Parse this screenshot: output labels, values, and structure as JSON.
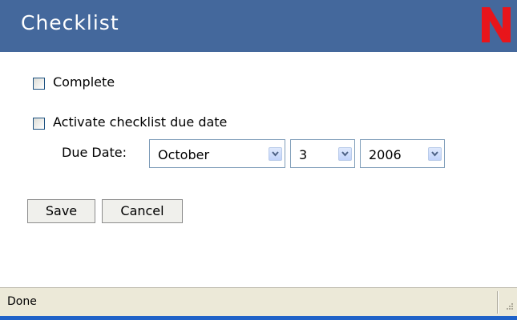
{
  "window": {
    "title": "Checklist"
  },
  "form": {
    "complete_label": "Complete",
    "activate_label": "Activate checklist due date",
    "due_date_label": "Due Date:",
    "month": "October",
    "day": "3",
    "year": "2006"
  },
  "buttons": {
    "save": "Save",
    "cancel": "Cancel"
  },
  "status": {
    "text": "Done"
  },
  "colors": {
    "title_bar": "#44689c",
    "logo": "#e8151b",
    "status_bar": "#ece9d8"
  },
  "icons": {
    "logo": "novell-n-logo",
    "dropdown": "chevron-down-icon",
    "grip": "resize-grip-icon"
  }
}
